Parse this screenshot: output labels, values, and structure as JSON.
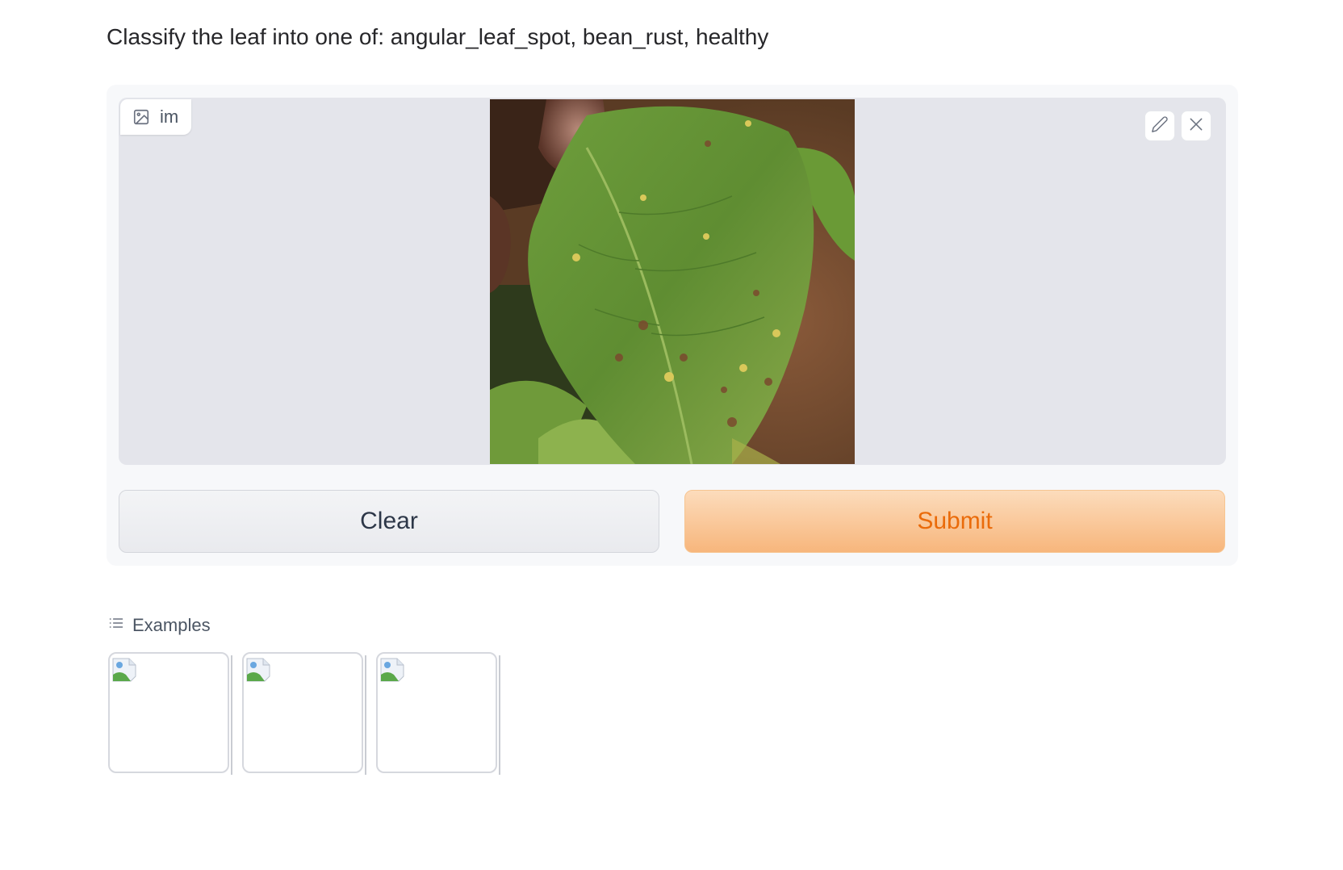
{
  "description": "Classify the leaf into one of: angular_leaf_spot, bean_rust, healthy",
  "image_input": {
    "label": "im",
    "image_icon": "image-icon",
    "edit_icon": "pencil-icon",
    "close_icon": "close-icon"
  },
  "buttons": {
    "clear": "Clear",
    "submit": "Submit"
  },
  "examples": {
    "label": "Examples",
    "icon": "list-icon",
    "items": [
      "broken-image-icon",
      "broken-image-icon",
      "broken-image-icon"
    ]
  },
  "colors": {
    "accent": "#ea6b0a",
    "submit_bg": "#f7b67c",
    "image_bg": "#e4e5eb"
  }
}
